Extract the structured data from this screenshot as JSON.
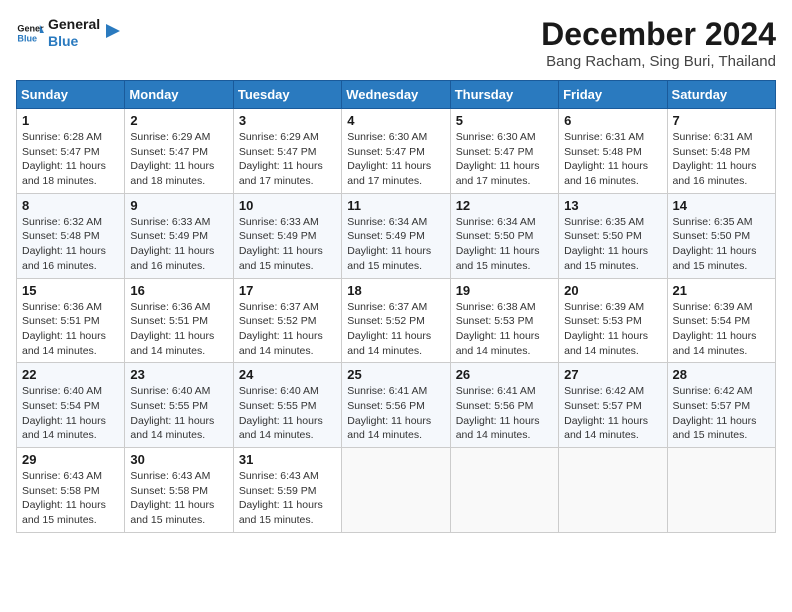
{
  "header": {
    "logo_line1": "General",
    "logo_line2": "Blue",
    "month_year": "December 2024",
    "location": "Bang Racham, Sing Buri, Thailand"
  },
  "calendar": {
    "days_of_week": [
      "Sunday",
      "Monday",
      "Tuesday",
      "Wednesday",
      "Thursday",
      "Friday",
      "Saturday"
    ],
    "weeks": [
      [
        null,
        {
          "day": "2",
          "info": "Sunrise: 6:29 AM\nSunset: 5:47 PM\nDaylight: 11 hours\nand 18 minutes."
        },
        {
          "day": "3",
          "info": "Sunrise: 6:29 AM\nSunset: 5:47 PM\nDaylight: 11 hours\nand 17 minutes."
        },
        {
          "day": "4",
          "info": "Sunrise: 6:30 AM\nSunset: 5:47 PM\nDaylight: 11 hours\nand 17 minutes."
        },
        {
          "day": "5",
          "info": "Sunrise: 6:30 AM\nSunset: 5:47 PM\nDaylight: 11 hours\nand 17 minutes."
        },
        {
          "day": "6",
          "info": "Sunrise: 6:31 AM\nSunset: 5:48 PM\nDaylight: 11 hours\nand 16 minutes."
        },
        {
          "day": "7",
          "info": "Sunrise: 6:31 AM\nSunset: 5:48 PM\nDaylight: 11 hours\nand 16 minutes."
        }
      ],
      [
        {
          "day": "1",
          "info": "Sunrise: 6:28 AM\nSunset: 5:47 PM\nDaylight: 11 hours\nand 18 minutes."
        },
        {
          "day": "9",
          "info": "Sunrise: 6:33 AM\nSunset: 5:49 PM\nDaylight: 11 hours\nand 16 minutes."
        },
        {
          "day": "10",
          "info": "Sunrise: 6:33 AM\nSunset: 5:49 PM\nDaylight: 11 hours\nand 15 minutes."
        },
        {
          "day": "11",
          "info": "Sunrise: 6:34 AM\nSunset: 5:49 PM\nDaylight: 11 hours\nand 15 minutes."
        },
        {
          "day": "12",
          "info": "Sunrise: 6:34 AM\nSunset: 5:50 PM\nDaylight: 11 hours\nand 15 minutes."
        },
        {
          "day": "13",
          "info": "Sunrise: 6:35 AM\nSunset: 5:50 PM\nDaylight: 11 hours\nand 15 minutes."
        },
        {
          "day": "14",
          "info": "Sunrise: 6:35 AM\nSunset: 5:50 PM\nDaylight: 11 hours\nand 15 minutes."
        }
      ],
      [
        {
          "day": "8",
          "info": "Sunrise: 6:32 AM\nSunset: 5:48 PM\nDaylight: 11 hours\nand 16 minutes."
        },
        {
          "day": "16",
          "info": "Sunrise: 6:36 AM\nSunset: 5:51 PM\nDaylight: 11 hours\nand 14 minutes."
        },
        {
          "day": "17",
          "info": "Sunrise: 6:37 AM\nSunset: 5:52 PM\nDaylight: 11 hours\nand 14 minutes."
        },
        {
          "day": "18",
          "info": "Sunrise: 6:37 AM\nSunset: 5:52 PM\nDaylight: 11 hours\nand 14 minutes."
        },
        {
          "day": "19",
          "info": "Sunrise: 6:38 AM\nSunset: 5:53 PM\nDaylight: 11 hours\nand 14 minutes."
        },
        {
          "day": "20",
          "info": "Sunrise: 6:39 AM\nSunset: 5:53 PM\nDaylight: 11 hours\nand 14 minutes."
        },
        {
          "day": "21",
          "info": "Sunrise: 6:39 AM\nSunset: 5:54 PM\nDaylight: 11 hours\nand 14 minutes."
        }
      ],
      [
        {
          "day": "15",
          "info": "Sunrise: 6:36 AM\nSunset: 5:51 PM\nDaylight: 11 hours\nand 14 minutes."
        },
        {
          "day": "23",
          "info": "Sunrise: 6:40 AM\nSunset: 5:55 PM\nDaylight: 11 hours\nand 14 minutes."
        },
        {
          "day": "24",
          "info": "Sunrise: 6:40 AM\nSunset: 5:55 PM\nDaylight: 11 hours\nand 14 minutes."
        },
        {
          "day": "25",
          "info": "Sunrise: 6:41 AM\nSunset: 5:56 PM\nDaylight: 11 hours\nand 14 minutes."
        },
        {
          "day": "26",
          "info": "Sunrise: 6:41 AM\nSunset: 5:56 PM\nDaylight: 11 hours\nand 14 minutes."
        },
        {
          "day": "27",
          "info": "Sunrise: 6:42 AM\nSunset: 5:57 PM\nDaylight: 11 hours\nand 14 minutes."
        },
        {
          "day": "28",
          "info": "Sunrise: 6:42 AM\nSunset: 5:57 PM\nDaylight: 11 hours\nand 15 minutes."
        }
      ],
      [
        {
          "day": "22",
          "info": "Sunrise: 6:40 AM\nSunset: 5:54 PM\nDaylight: 11 hours\nand 14 minutes."
        },
        {
          "day": "30",
          "info": "Sunrise: 6:43 AM\nSunset: 5:58 PM\nDaylight: 11 hours\nand 15 minutes."
        },
        {
          "day": "31",
          "info": "Sunrise: 6:43 AM\nSunset: 5:59 PM\nDaylight: 11 hours\nand 15 minutes."
        },
        null,
        null,
        null,
        null
      ],
      [
        {
          "day": "29",
          "info": "Sunrise: 6:43 AM\nSunset: 5:58 PM\nDaylight: 11 hours\nand 15 minutes."
        },
        null,
        null,
        null,
        null,
        null,
        null
      ]
    ]
  }
}
